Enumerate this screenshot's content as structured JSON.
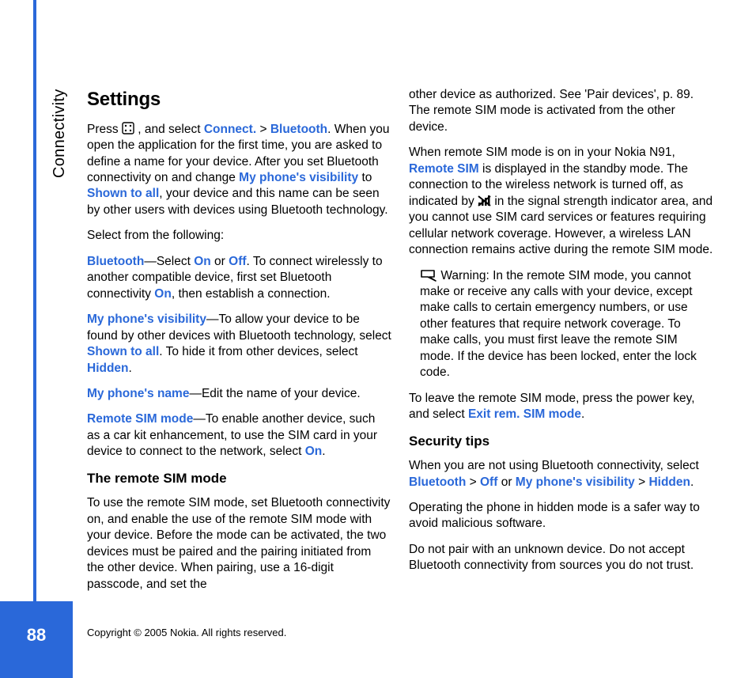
{
  "meta": {
    "section_label": "Connectivity",
    "page_number": "88",
    "copyright": "Copyright © 2005 Nokia. All rights reserved."
  },
  "col1": {
    "h1": "Settings",
    "p1_a": "Press ",
    "p1_b": " , and select ",
    "p1_connect": "Connect.",
    "p1_gt": " > ",
    "p1_bt": "Bluetooth",
    "p1_c": ". When you open the application for the first time, you are asked to define a name for your device. After you set Bluetooth connectivity on and change ",
    "p1_link1": "My phone's visibility",
    "p1_d": " to ",
    "p1_link2": "Shown to all",
    "p1_e": ", your device and this name can be seen by other users with devices using Bluetooth technology.",
    "p2": "Select from the following:",
    "p3_lead": "Bluetooth",
    "p3_a": "—Select ",
    "p3_on": "On",
    "p3_or": " or ",
    "p3_off": "Off",
    "p3_b": ". To connect wirelessly to another compatible device, first set Bluetooth connectivity ",
    "p3_on2": "On",
    "p3_c": ", then establish a connection.",
    "p4_lead": "My phone's visibility",
    "p4_a": "—To allow your device to be found by other devices with Bluetooth technology, select ",
    "p4_shown": "Shown to all",
    "p4_b": ". To hide it from other devices, select ",
    "p4_hidden": "Hidden",
    "p4_c": ".",
    "p5_lead": "My phone's name",
    "p5_a": "—Edit the name of your device.",
    "p6_lead": "Remote SIM mode",
    "p6_a": "—To enable another device, such as a car kit enhancement, to use the SIM card in your device to connect to the network, select ",
    "p6_on": "On",
    "p6_b": ".",
    "h2": "The remote SIM mode",
    "p7": "To use the remote SIM mode, set Bluetooth connectivity on, and enable the use of the remote SIM mode with your device. Before the mode can be activated, the two devices must be paired and the pairing initiated from the other device. When pairing, use a 16-digit passcode, and set the"
  },
  "col2": {
    "p1": "other device as authorized. See 'Pair devices', p. 89. The remote SIM mode is activated from the other device.",
    "p2_a": "When remote SIM mode is on in your Nokia N91, ",
    "p2_remote": "Remote SIM",
    "p2_b": " is displayed in the standby mode. The connection to the wireless network is turned off, as indicated by ",
    "p2_c": " in the signal strength indicator area, and you cannot use SIM card services or features requiring cellular network coverage. However, a wireless LAN connection remains active during the remote SIM mode.",
    "warn": "Warning: In the remote SIM mode, you cannot make or receive any calls with your device, except make calls to certain emergency numbers, or use other features that require network coverage. To make calls, you must first leave the remote SIM mode. If the device has been locked, enter the lock code.",
    "p3_a": "To leave the remote SIM mode, press the power key, and select ",
    "p3_exit": "Exit rem. SIM mode",
    "p3_b": ".",
    "h2": "Security tips",
    "p4_a": "When you are not using Bluetooth connectivity, select ",
    "p4_bt": "Bluetooth",
    "p4_gt1": " > ",
    "p4_off": "Off",
    "p4_or": " or ",
    "p4_vis": "My phone's visibility",
    "p4_gt2": " > ",
    "p4_hidden": "Hidden",
    "p4_b": ".",
    "p5": "Operating the phone in hidden mode is a safer way to avoid malicious software.",
    "p6": "Do not pair with an unknown device. Do not accept Bluetooth connectivity from sources you do not trust."
  }
}
